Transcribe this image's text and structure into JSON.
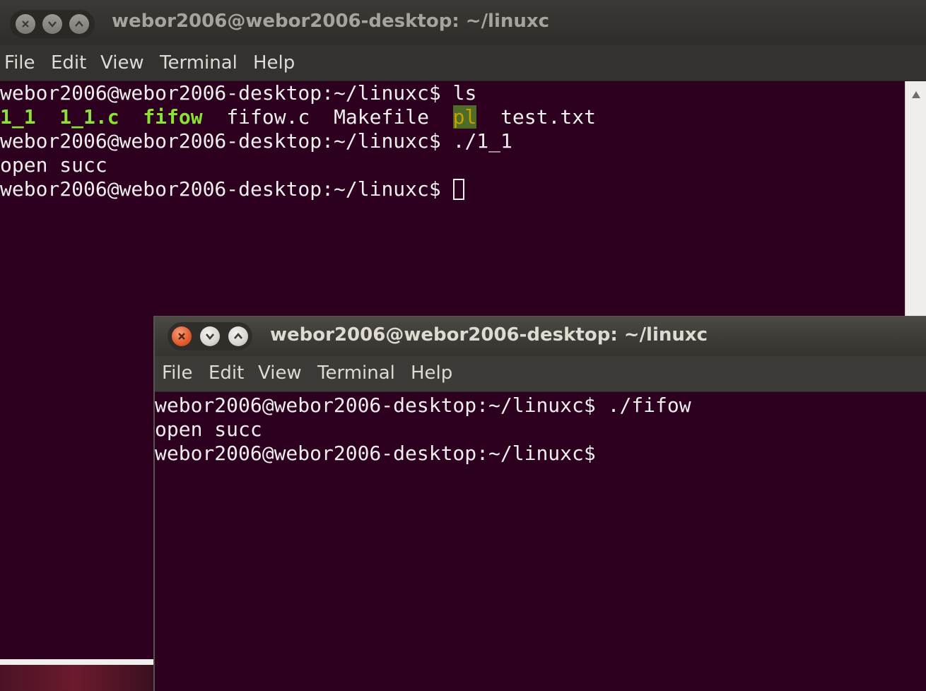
{
  "windows": [
    {
      "title": "webor2006@webor2006-desktop: ~/linuxc",
      "menu": [
        "File",
        "Edit",
        "View",
        "Terminal",
        "Help"
      ],
      "terminal": {
        "prompt": "webor2006@webor2006-desktop:~/linuxc$",
        "line1_cmd": " ls",
        "ls_output": {
          "f1": "1_1",
          "f2": "1_1.c",
          "f3": "fifow",
          "f4": "fifow.c",
          "f5": "Makefile",
          "f6": "pl",
          "f7": "test.txt"
        },
        "line3_cmd": " ./1_1",
        "line4": "open succ",
        "line5_cmd": " "
      }
    },
    {
      "title": "webor2006@webor2006-desktop: ~/linuxc",
      "menu": [
        "File",
        "Edit",
        "View",
        "Terminal",
        "Help"
      ],
      "terminal": {
        "prompt": "webor2006@webor2006-desktop:~/linuxc$",
        "line1_cmd": " ./fifow",
        "line2": "open succ",
        "line3_cmd": ""
      }
    }
  ],
  "colors": {
    "terminal_bg": "#2c001e",
    "terminal_fg": "#eeeeec",
    "executable_green": "#8ae234",
    "close_button_orange": "#e2592d"
  },
  "icons": [
    "close-icon",
    "minimize-icon",
    "maximize-icon",
    "scroll-up-arrow-icon"
  ]
}
